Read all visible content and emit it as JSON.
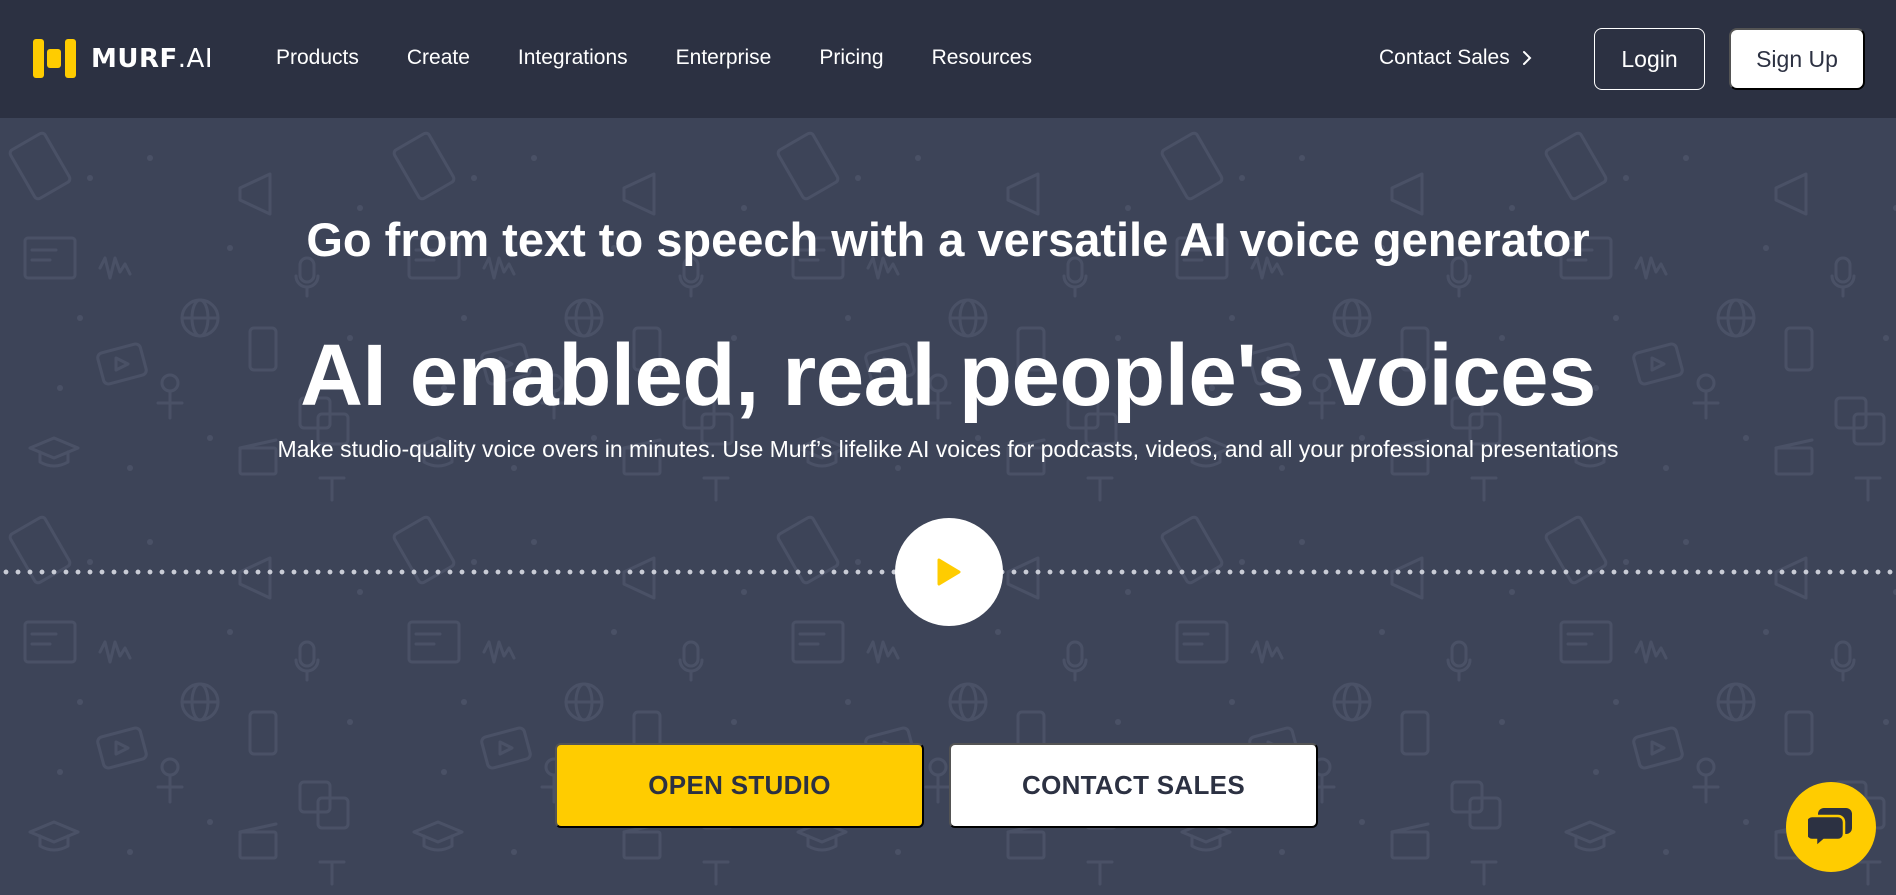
{
  "brand": {
    "name_bold": "MURF",
    "name_thin": ".AI",
    "logo_icon": "murf-logo-icon",
    "accent_color": "#ffcc00",
    "nav_bg": "#2c3142",
    "hero_bg": "#3d4458"
  },
  "nav": {
    "links": [
      "Products",
      "Create",
      "Integrations",
      "Enterprise",
      "Pricing",
      "Resources"
    ],
    "contact_sales": "Contact Sales",
    "login": "Login",
    "signup": "Sign Up"
  },
  "hero": {
    "subtitle": "Go from text to speech with a versatile AI voice generator",
    "headline": "AI enabled, real people's voices",
    "description": "Make studio-quality voice overs in minutes. Use Murf’s lifelike AI voices for podcasts, videos, and all your professional presentations",
    "play_icon": "play-icon",
    "primary_cta": "OPEN STUDIO",
    "secondary_cta": "CONTACT SALES"
  },
  "chat": {
    "icon": "chat-bubble-icon"
  }
}
